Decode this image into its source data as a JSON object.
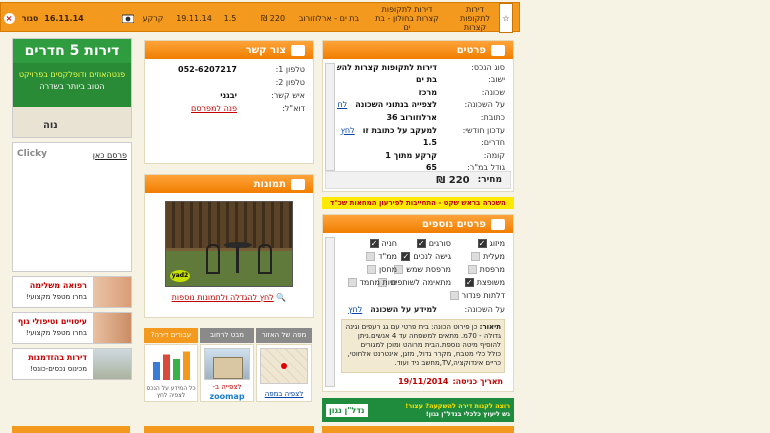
{
  "topbar": {
    "type_line1": "דירות",
    "type_line2": "לתקופות",
    "type_line3": "קצרות",
    "type_b_line1": "דירות לתקופות",
    "type_b_line2": "קצרות בחולון - בת",
    "type_b_line3": "ים",
    "address": "בת ים - ארלוזורוב",
    "price": "220 ₪",
    "rooms": "1.5",
    "date": "19.11.14",
    "floor": "קרקע",
    "status": "סגור",
    "date_red": "16.11.14"
  },
  "details": {
    "title": "פרטים",
    "rows": [
      {
        "label": "סוג הנכס:",
        "value": "דירות לתקופות קצרות להשכרה"
      },
      {
        "label": "ישוב:",
        "value": "בת ים"
      },
      {
        "label": "שכונה:",
        "value": "מרכז"
      },
      {
        "label": "על השכונה:",
        "value": "לצפייה בנתוני השכונה",
        "link": "לחץ"
      },
      {
        "label": "כתובת:",
        "value": "ארלוזורוב 36"
      },
      {
        "label": "עדכון חודשי:",
        "value": "למעקב על כתובת זו",
        "link": "לחץ"
      },
      {
        "label": "חדרים:",
        "value": "1.5"
      },
      {
        "label": "קומה:",
        "value": "קרקע מתוך 1"
      },
      {
        "label": "גודל במ\"ר:",
        "value": "65"
      }
    ],
    "price_label": "מחיר:",
    "price_value": "220 ₪"
  },
  "contact": {
    "title": "צור קשר",
    "phone1_label": "טלפון 1:",
    "phone1": "052-6207217",
    "phone2_label": "טלפון 2:",
    "phone2": "",
    "person_label": "איש קשר:",
    "person": "יבגני",
    "email_label": "דוא\"ל:",
    "email_link": "פנה למפרסם"
  },
  "photos": {
    "title": "תמונות",
    "enlarge": "לחץ להגדלה ולתמונות נוספות"
  },
  "broker_notice": "השכרה בראש שקט - התחייבות לפירעון המחאות שכ\"ד",
  "extras": {
    "title": "פרטים נוספים",
    "items": [
      {
        "label": "מיזוג",
        "state": "on"
      },
      {
        "label": "סורגים",
        "state": "on"
      },
      {
        "label": "חניה",
        "state": "on"
      },
      {
        "label": "מעלית",
        "state": "off"
      },
      {
        "label": "גישה לנכים",
        "state": "on"
      },
      {
        "label": "ממ\"ד",
        "state": "off"
      },
      {
        "label": "מרפסת",
        "state": "off"
      },
      {
        "label": "מרפסת שמש",
        "state": "off"
      },
      {
        "label": "מחסן",
        "state": "off"
      },
      {
        "label": "משופצת",
        "state": "on"
      },
      {
        "label": "מתאימה לשותפים",
        "state": "off"
      },
      {
        "label": "חיות מחמד",
        "state": "off"
      },
      {
        "label": "דלתות פנדור",
        "state": "off"
      }
    ],
    "schools_label": "על השכונה:",
    "schools_text": "למידע על השכונה",
    "schools_link": "לחץ",
    "desc_title": "תיאור:",
    "desc": "כן פירוט הכונה: בית פרטי עם גג רעפים וגינה גדולה - 70מ. מתאים למשפחה עד 4 אנשים.ניתן להוסיף מיטה נוספת.הבית מרוהט ומוכן למגורים כולל כלי מטבח, מקרר גדול, מזגן, אינטרנט אלחוטי, כריים אינדוקציה,TV,מחשב ניד ועוד.",
    "date_label": "תאריך כניסה:",
    "date_value": "19/11/2014"
  },
  "banner_ad": {
    "line1": "רוצה לקנות דירה להשקעה? עצור!",
    "line2": "גש ליעוץ כלכלי בנדל\"ן נגון!",
    "brand": "נדל\"ן נגון"
  },
  "tabs": {
    "map": "מפה של האזור",
    "street": "מבט לרחוב",
    "rent": "עבורים דירה?",
    "map_link": "לצפיה במפה",
    "street_link": "לצפייה ב-",
    "zoom": "zoomap",
    "chart_link": "כל המידע על הנכס לצפיה לחץ"
  },
  "ads": {
    "top_line1": "דירות 5 חדרים",
    "top_line2": "פנטהאוזים ודופלקסים בפרויקט",
    "top_line3": "הטוב ביותר בשדרה",
    "top_brand": "נוה",
    "clicky_label": "פרסם כאן",
    "clicky": "Clicky",
    "ad1_title": "רפואה משלימה",
    "ad1_sub": "בחרו מטפל מקצועי!",
    "ad2_title": "עיסויים וטיפולי גוף",
    "ad2_sub": "בחרו מטפל מקצועי!",
    "ad3_title": "דירות בהזדמנות",
    "ad3_sub": "מכינוס נכסים-כונס!"
  },
  "colors": {
    "accent": "#f39a1e",
    "red": "#c40000",
    "link": "#0645ad"
  }
}
